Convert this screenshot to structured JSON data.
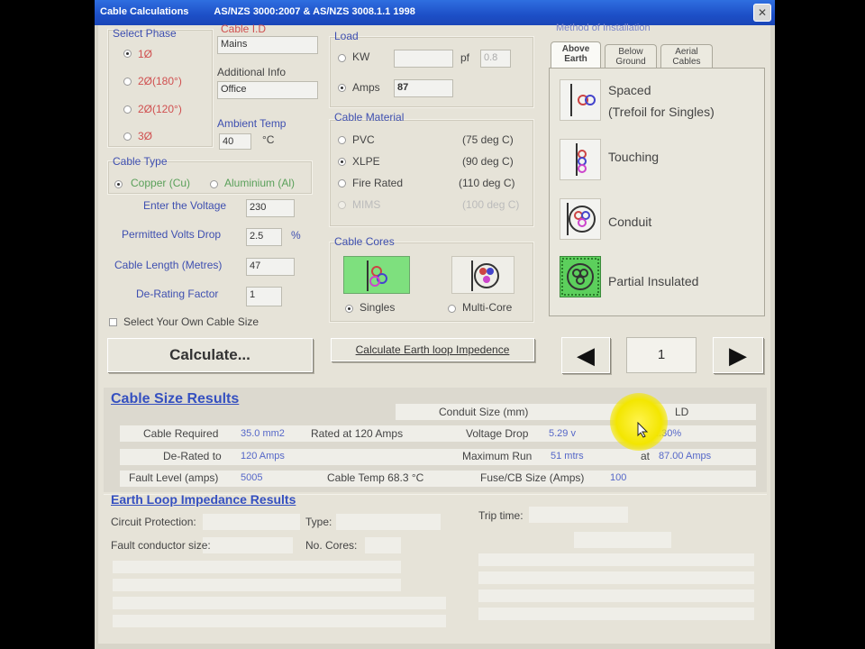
{
  "window": {
    "title_parts": [
      "Cable Calculations",
      "AS/NZS 3000:2007 & AS/NZS 3008.1.1 1998"
    ],
    "close_glyph": "✕"
  },
  "select_phase": {
    "label": "Select Phase",
    "options": [
      "1Ø",
      "2Ø(180°)",
      "2Ø(120°)",
      "3Ø"
    ],
    "selected": 0
  },
  "cable_id": {
    "label": "Cable I.D",
    "value": "Mains"
  },
  "additional_info": {
    "label": "Additional Info",
    "value": "Office"
  },
  "ambient_temp": {
    "label": "Ambient Temp",
    "value": "40",
    "unit": "°C"
  },
  "load": {
    "label": "Load",
    "kw_label": "KW",
    "pf_label": "pf",
    "pf_value": "0.8",
    "amps_label": "Amps",
    "amps_value": "87"
  },
  "cable_material": {
    "label": "Cable Material",
    "options": [
      {
        "name": "PVC",
        "temp": "(75 deg C)"
      },
      {
        "name": "XLPE",
        "temp": "(90 deg C)"
      },
      {
        "name": "Fire Rated",
        "temp": "(110 deg C)"
      },
      {
        "name": "MIMS",
        "temp": "(100 deg C)"
      }
    ],
    "selected": 1
  },
  "cable_type": {
    "label": "Cable Type",
    "copper": "Copper (Cu)",
    "aluminium": "Aluminium (Al)"
  },
  "inputs": {
    "voltage_label": "Enter the Voltage",
    "voltage_value": "230",
    "volts_drop_label": "Permitted Volts Drop",
    "volts_drop_value": "2.5",
    "volts_drop_unit": "%",
    "length_label": "Cable Length (Metres)",
    "length_value": "47",
    "derating_label": "De-Rating Factor",
    "derating_value": "1",
    "own_size_label": "Select Your Own Cable Size"
  },
  "cable_cores": {
    "label": "Cable Cores",
    "singles": "Singles",
    "multicore": "Multi-Core"
  },
  "buttons": {
    "calculate": "Calculate...",
    "earth_loop": "Calculate Earth loop Impedence",
    "prev_glyph": "◀",
    "next_glyph": "▶",
    "page": "1"
  },
  "installation": {
    "label": "Method of Installation",
    "tabs": [
      "Above Earth",
      "Below Ground",
      "Aerial Cables"
    ],
    "methods": [
      "Spaced",
      "(Trefoil for Singles)",
      "Touching",
      "Conduit",
      "Partial Insulated"
    ]
  },
  "results": {
    "title": "Cable Size Results",
    "conduit_label": "Conduit Size (mm)",
    "hd": "HD",
    "ld": "LD",
    "cable_required_label": "Cable Required",
    "cable_required_value": "35.0 mm2",
    "rated_at": "Rated at 120 Amps",
    "voltage_drop_label": "Voltage Drop",
    "voltage_drop_value": "5.29 v",
    "voltage_drop_pct": "2.30%",
    "derated_label": "De-Rated to",
    "derated_value": "120 Amps",
    "max_run_label": "Maximum Run",
    "max_run_value": "51 mtrs",
    "at_label": "at",
    "at_value": "87.00 Amps",
    "fault_label": "Fault Level (amps)",
    "fault_value": "5005",
    "cable_temp": "Cable Temp 68.3 °C",
    "fuse_label": "Fuse/CB Size (Amps)",
    "fuse_value": "100"
  },
  "earth_loop": {
    "title": "Earth Loop Impedance Results",
    "circuit_protection": "Circuit Protection:",
    "type": "Type:",
    "trip_time": "Trip time:",
    "fault_conductor": "Fault conductor size:",
    "no_cores": "No. Cores:"
  },
  "colors": {
    "title_bar": "#1d4fc7",
    "highlight_green": "#66dd66",
    "cursor_yellow": "#f3e600",
    "label_blue": "#3e4fb0"
  }
}
